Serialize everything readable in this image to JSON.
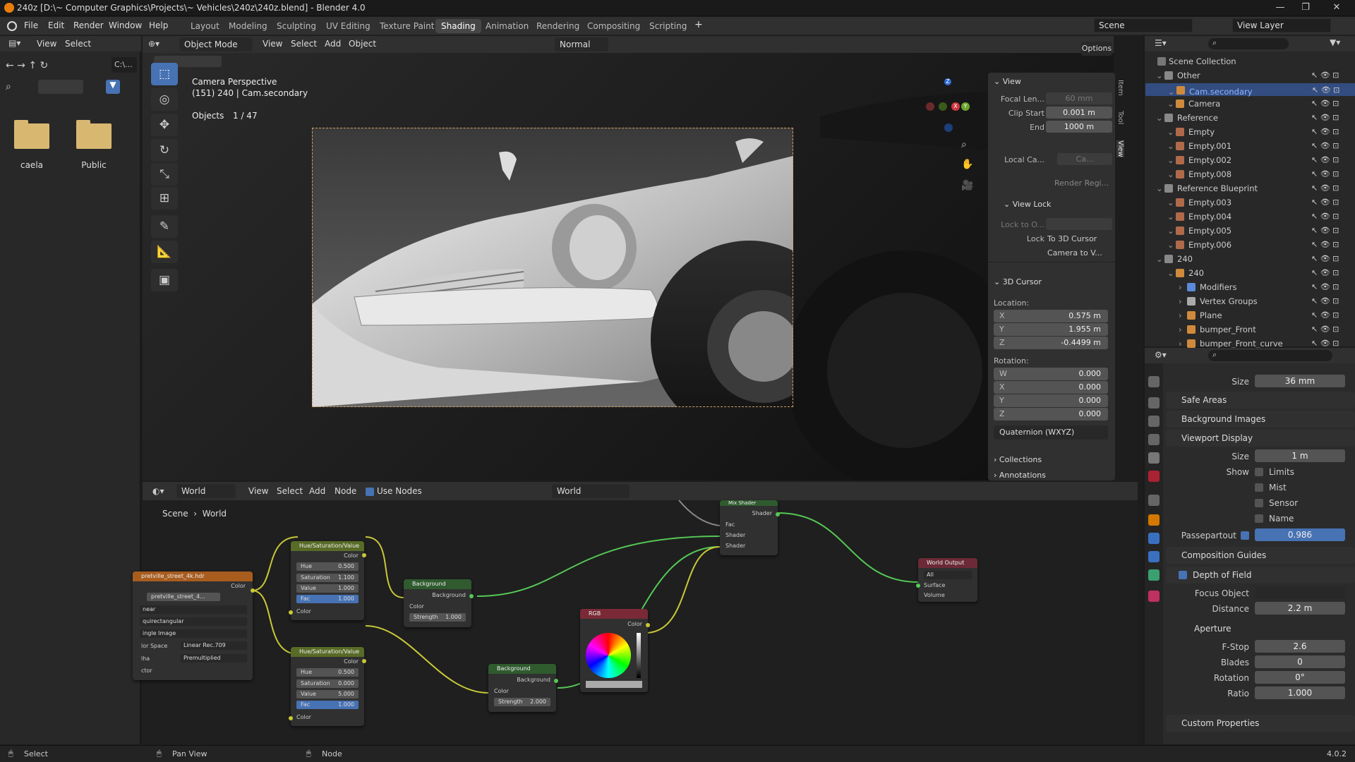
{
  "window": {
    "title": "240z [D:\\~ Computer Graphics\\Projects\\~ Vehicles\\240z\\240z.blend] - Blender 4.0"
  },
  "menu": [
    "File",
    "Edit",
    "Render",
    "Window",
    "Help"
  ],
  "workspaces": [
    "Layout",
    "Modeling",
    "Sculpting",
    "UV Editing",
    "Texture Paint",
    "Shading",
    "Animation",
    "Rendering",
    "Compositing",
    "Scripting"
  ],
  "active_workspace": "Shading",
  "top_right": {
    "scene": "Scene",
    "view_layer": "View Layer"
  },
  "filebrowser": {
    "menu": [
      "View",
      "Select"
    ],
    "path": "C:\\...",
    "folders": [
      "caela",
      "Public"
    ]
  },
  "viewport": {
    "mode": "Object Mode",
    "menu": [
      "View",
      "Select",
      "Add",
      "Object"
    ],
    "orientation": "Normal",
    "options": "Options",
    "info_line1": "Camera Perspective",
    "info_line2": "(151) 240 | Cam.secondary",
    "objects_label": "Objects",
    "objects_count": "1 / 47",
    "gizmo": {
      "z": "Z",
      "y": "Y",
      "x": "X"
    }
  },
  "npanel": {
    "tabs": [
      "Item",
      "Tool",
      "View"
    ],
    "view_title": "View",
    "focal_label": "Focal Len...",
    "focal_value": "60 mm",
    "clip_start_label": "Clip Start",
    "clip_start": "0.001 m",
    "clip_end_label": "End",
    "clip_end": "1000 m",
    "local_cam_label": "Local Ca...",
    "local_cam_value": "Ca...",
    "render_region": "Render Regi...",
    "view_lock_title": "View Lock",
    "lock_to_label": "Lock to O...",
    "lock_label": "Lock",
    "to_3d_cursor": "To 3D Cursor",
    "camera_to_view": "Camera to V...",
    "cursor_title": "3D Cursor",
    "location_label": "Location:",
    "loc": [
      {
        "k": "X",
        "v": "0.575 m"
      },
      {
        "k": "Y",
        "v": "1.955 m"
      },
      {
        "k": "Z",
        "v": "-0.4499 m"
      }
    ],
    "rotation_label": "Rotation:",
    "rot": [
      {
        "k": "W",
        "v": "0.000"
      },
      {
        "k": "X",
        "v": "0.000"
      },
      {
        "k": "Y",
        "v": "0.000"
      },
      {
        "k": "Z",
        "v": "0.000"
      }
    ],
    "rot_mode": "Quaternion (WXYZ)",
    "collections": "Collections",
    "annotations": "Annotations"
  },
  "outliner": {
    "root": "Scene Collection",
    "rows": [
      {
        "name": "Other",
        "indent": 1,
        "type": "collection"
      },
      {
        "name": "Cam.secondary",
        "indent": 2,
        "type": "camera",
        "selected": true
      },
      {
        "name": "Camera",
        "indent": 2,
        "type": "camera"
      },
      {
        "name": "Reference",
        "indent": 1,
        "type": "collection"
      },
      {
        "name": "Empty",
        "indent": 2,
        "type": "image"
      },
      {
        "name": "Empty.001",
        "indent": 2,
        "type": "image"
      },
      {
        "name": "Empty.002",
        "indent": 2,
        "type": "image"
      },
      {
        "name": "Empty.008",
        "indent": 2,
        "type": "image"
      },
      {
        "name": "Reference Blueprint",
        "indent": 1,
        "type": "collection"
      },
      {
        "name": "Empty.003",
        "indent": 2,
        "type": "image"
      },
      {
        "name": "Empty.004",
        "indent": 2,
        "type": "image"
      },
      {
        "name": "Empty.005",
        "indent": 2,
        "type": "image"
      },
      {
        "name": "Empty.006",
        "indent": 2,
        "type": "image"
      },
      {
        "name": "240",
        "indent": 1,
        "type": "collection"
      },
      {
        "name": "240",
        "indent": 2,
        "type": "mesh"
      },
      {
        "name": "Modifiers",
        "indent": 3,
        "type": "modifier"
      },
      {
        "name": "Vertex Groups",
        "indent": 3,
        "type": "group"
      },
      {
        "name": "Plane",
        "indent": 3,
        "type": "mesh"
      },
      {
        "name": "bumper_Front",
        "indent": 3,
        "type": "mesh"
      },
      {
        "name": "bumper_Front_curve",
        "indent": 3,
        "type": "curve"
      }
    ]
  },
  "properties": {
    "size_label": "Size",
    "size_value": "36 mm",
    "safe_areas": "Safe Areas",
    "background_images": "Background Images",
    "viewport_display": "Viewport Display",
    "vd_size_label": "Size",
    "vd_size_value": "1 m",
    "show_label": "Show",
    "show_items": [
      "Limits",
      "Mist",
      "Sensor",
      "Name"
    ],
    "passepartout_label": "Passepartout",
    "passepartout_value": "0.986",
    "composition_guides": "Composition Guides",
    "depth_of_field": "Depth of Field",
    "focus_object_label": "Focus Object",
    "distance_label": "Distance",
    "distance_value": "2.2 m",
    "aperture": "Aperture",
    "fstop_label": "F-Stop",
    "fstop_value": "2.6",
    "blades_label": "Blades",
    "blades_value": "0",
    "rotation_label": "Rotation",
    "rotation_value": "0°",
    "ratio_label": "Ratio",
    "ratio_value": "1.000",
    "custom_properties": "Custom Properties"
  },
  "node_editor": {
    "world_label": "World",
    "menu": [
      "View",
      "Select",
      "Add",
      "Node"
    ],
    "use_nodes": "Use Nodes",
    "world_name": "World",
    "breadcrumb": [
      "Scene",
      "World"
    ],
    "nodes": {
      "env_title": "pretville_street_4k.hdr",
      "env_file": "pretville_street_4...",
      "env_color": "Color",
      "env_interp": "near",
      "env_proj": "quirectangular",
      "env_single": "ingle Image",
      "env_cs_label": "lor Space",
      "env_cs": "Linear Rec.709",
      "env_alpha_label": "lha",
      "env_alpha": "Premultiplied",
      "env_vector": "ctor",
      "hsv1_title": "Hue/Saturation/Value",
      "hsv1_color": "Color",
      "hsv1": [
        {
          "k": "Hue",
          "v": "0.500"
        },
        {
          "k": "Saturation",
          "v": "1.100"
        },
        {
          "k": "Value",
          "v": "1.000"
        },
        {
          "k": "Fac",
          "v": "1.000"
        }
      ],
      "hsv1_in": "Color",
      "hsv2_title": "Hue/Saturation/Value",
      "hsv2_color": "Color",
      "hsv2": [
        {
          "k": "Hue",
          "v": "0.500"
        },
        {
          "k": "Saturation",
          "v": "0.000"
        },
        {
          "k": "Value",
          "v": "5.000"
        },
        {
          "k": "Fac",
          "v": "1.000"
        }
      ],
      "hsv2_in": "Color",
      "bg1_title": "Background",
      "bg1_out": "Background",
      "bg1_color": "Color",
      "bg1_strength": "Strength",
      "bg1_strength_v": "1.000",
      "bg2_title": "Background",
      "bg2_out": "Background",
      "bg2_color": "Color",
      "bg2_strength": "Strength",
      "bg2_strength_v": "2.000",
      "mix_title": "Mix Shader",
      "mix_out": "Shader",
      "mix_fac": "Fac",
      "mix_s1": "Shader",
      "mix_s2": "Shader",
      "rgb_title": "RGB",
      "rgb_color": "Color",
      "wo_title": "World Output",
      "wo_target": "All",
      "wo_surface": "Surface",
      "wo_volume": "Volume"
    }
  },
  "status": {
    "select": "Select",
    "pan": "Pan View",
    "node": "Node",
    "version": "4.0.2"
  },
  "colors": {
    "accent": "#4772b3",
    "hsv_header": "#586b27",
    "bg_header": "#2f5b2f",
    "rgb_header": "#7a2a36",
    "image_header": "#a85d1f",
    "output_header": "#6b2a36",
    "link": "#c8c838",
    "link_green": "#55c855"
  }
}
